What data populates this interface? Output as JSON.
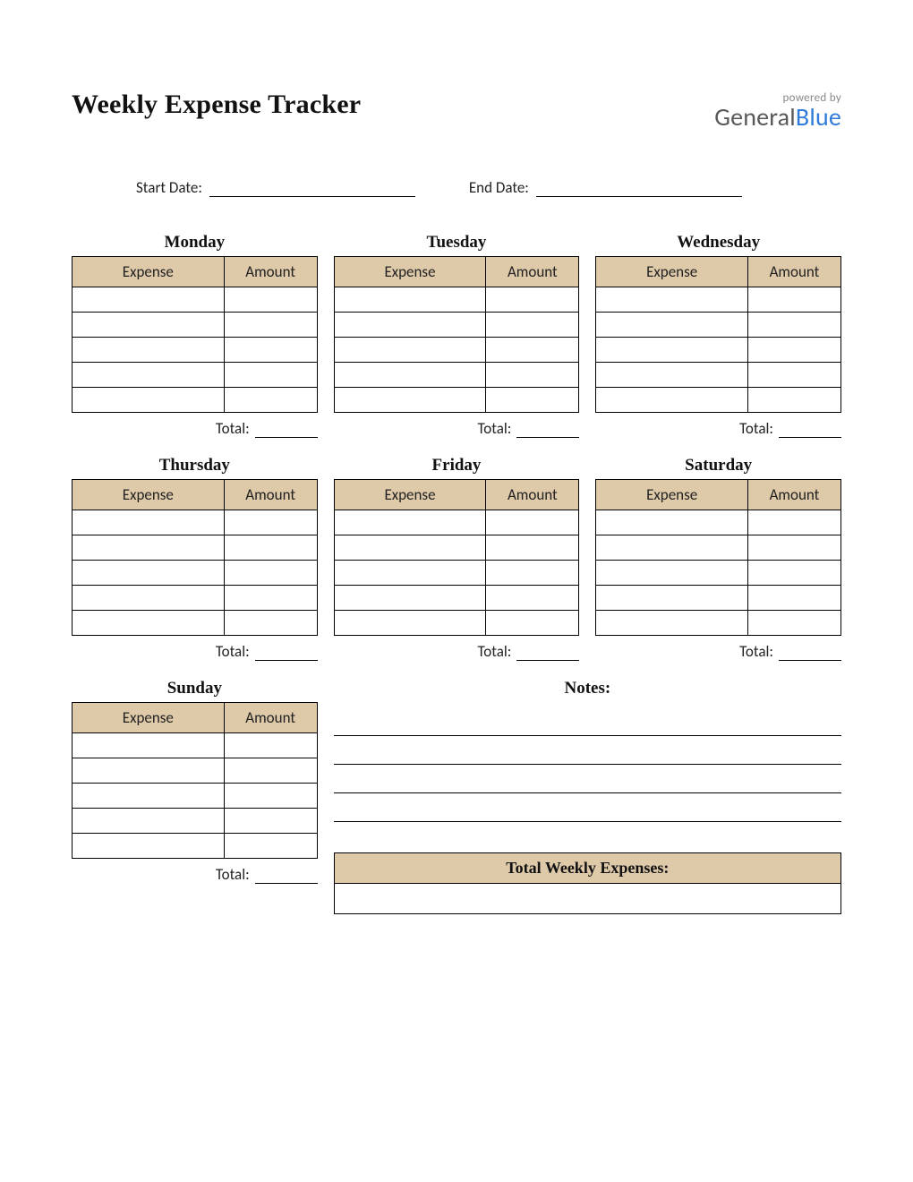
{
  "title": "Weekly Expense Tracker",
  "logo": {
    "powered": "powered by",
    "general": "General",
    "blue": "Blue"
  },
  "dates": {
    "start_label": "Start Date:",
    "end_label": "End Date:",
    "start_value": "",
    "end_value": ""
  },
  "columns": {
    "expense": "Expense",
    "amount": "Amount"
  },
  "total_label": "Total:",
  "days": [
    {
      "name": "Monday",
      "rows": [
        "",
        "",
        "",
        "",
        ""
      ],
      "total": ""
    },
    {
      "name": "Tuesday",
      "rows": [
        "",
        "",
        "",
        "",
        ""
      ],
      "total": ""
    },
    {
      "name": "Wednesday",
      "rows": [
        "",
        "",
        "",
        "",
        ""
      ],
      "total": ""
    },
    {
      "name": "Thursday",
      "rows": [
        "",
        "",
        "",
        "",
        ""
      ],
      "total": ""
    },
    {
      "name": "Friday",
      "rows": [
        "",
        "",
        "",
        "",
        ""
      ],
      "total": ""
    },
    {
      "name": "Saturday",
      "rows": [
        "",
        "",
        "",
        "",
        ""
      ],
      "total": ""
    },
    {
      "name": "Sunday",
      "rows": [
        "",
        "",
        "",
        "",
        ""
      ],
      "total": ""
    }
  ],
  "notes": {
    "heading": "Notes:",
    "lines": [
      "",
      "",
      "",
      ""
    ]
  },
  "total_weekly": {
    "label": "Total Weekly Expenses:",
    "value": ""
  }
}
